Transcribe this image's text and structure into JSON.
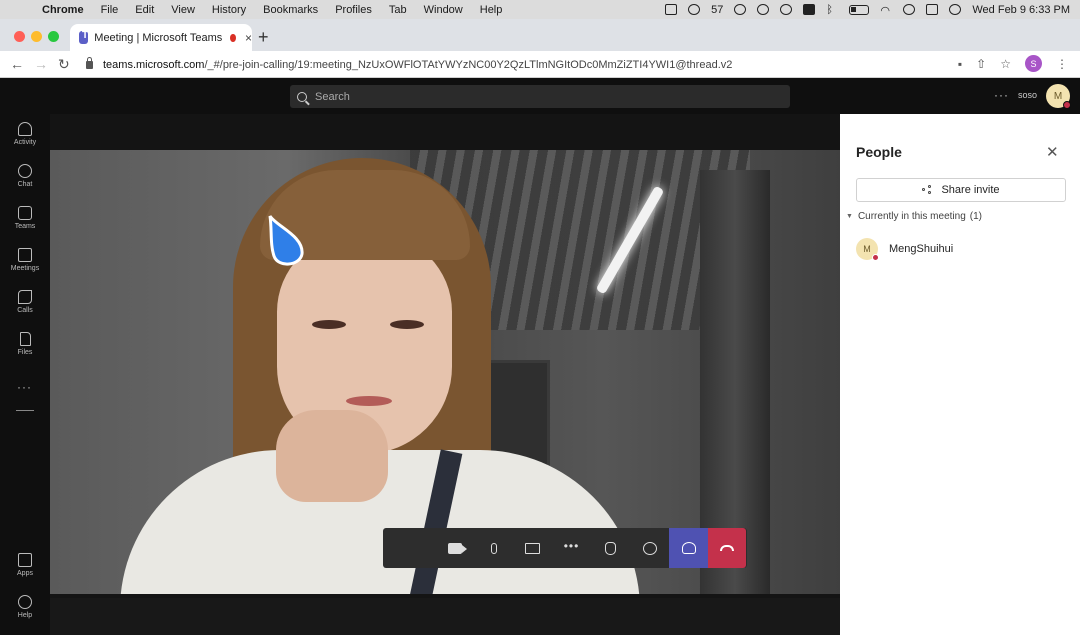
{
  "menubar": {
    "app": "Chrome",
    "items": [
      "File",
      "Edit",
      "View",
      "History",
      "Bookmarks",
      "Profiles",
      "Tab",
      "Window",
      "Help"
    ],
    "wechat_count": "57",
    "clock": "Wed Feb 9  6:33 PM"
  },
  "tab": {
    "title": "Meeting | Microsoft Teams",
    "close": "×",
    "new_tab": "+"
  },
  "address": {
    "host": "teams.microsoft.com",
    "path": "/_#/pre-join-calling/19:meeting_NzUxOWFlOTAtYWYzNC00Y2QzLTlmNGItODc0MmZiZTI4YWI1@thread.v2",
    "profile_initial": "S"
  },
  "teams_header": {
    "search_placeholder": "Search",
    "more": "···",
    "user_name": "soso",
    "avatar_initial": "M"
  },
  "rail": {
    "items": [
      {
        "label": "Activity",
        "icon": "bell-icon"
      },
      {
        "label": "Chat",
        "icon": "chat-icon"
      },
      {
        "label": "Teams",
        "icon": "teams-icon"
      },
      {
        "label": "Meetings",
        "icon": "calendar-icon"
      },
      {
        "label": "Calls",
        "icon": "phone-icon"
      },
      {
        "label": "Files",
        "icon": "file-icon"
      }
    ],
    "more": "···",
    "bottom": [
      {
        "label": "Apps",
        "icon": "apps-icon"
      },
      {
        "label": "Help",
        "icon": "help-icon"
      }
    ]
  },
  "controls": {
    "more": "•••",
    "icons": [
      "camera-icon",
      "microphone-icon",
      "share-screen-icon",
      "more-icon",
      "raise-hand-icon",
      "chat-icon",
      "people-icon",
      "hang-up-icon"
    ],
    "people_color": "#4f52b2",
    "hangup_color": "#c4314b"
  },
  "people_panel": {
    "title": "People",
    "close": "✕",
    "share_invite": "Share invite",
    "section_label": "Currently in this meeting",
    "section_count": "(1)",
    "participants": [
      {
        "name": "MengShuihui",
        "initial": "M",
        "status_color": "#c4314b"
      }
    ]
  }
}
